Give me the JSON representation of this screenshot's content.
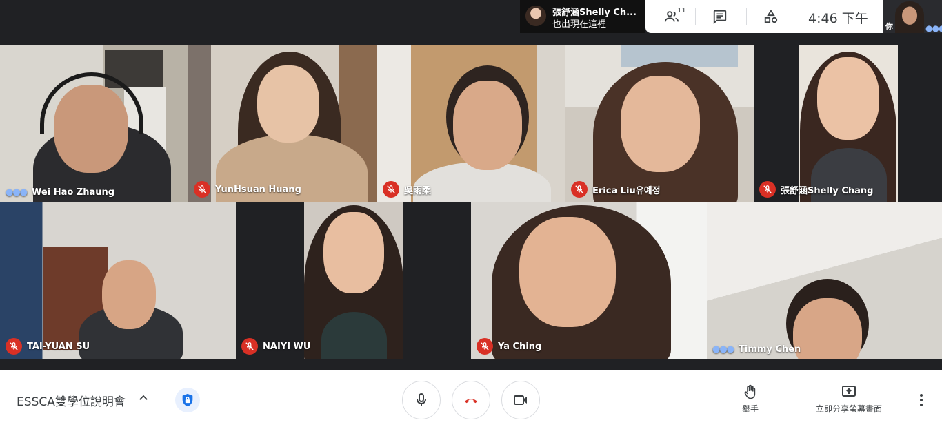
{
  "notification": {
    "name": "張舒涵Shelly Ch...",
    "message": "也出現在這裡"
  },
  "info_panel": {
    "participants_count": "11",
    "time": "4:46 下午"
  },
  "self_view": {
    "label": "你"
  },
  "tiles": [
    {
      "name": "Wei Hao Zhaung",
      "muted": false
    },
    {
      "name": "YunHsuan Huang",
      "muted": true
    },
    {
      "name": "吳雨柔",
      "muted": true
    },
    {
      "name": "Erica Liu유예정",
      "muted": true
    },
    {
      "name": "張舒涵Shelly Chang",
      "muted": true
    },
    {
      "name": "TAI-YUAN SU",
      "muted": true
    },
    {
      "name": "NAIYI WU",
      "muted": true
    },
    {
      "name": "Ya Ching",
      "muted": true
    },
    {
      "name": "Timmy Chen",
      "muted": false
    }
  ],
  "bottom_bar": {
    "meeting_title": "ESSCA雙學位說明會",
    "raise_hand_label": "舉手",
    "present_label": "立即分享螢幕畫面"
  },
  "colors": {
    "mute_red": "#d93025",
    "talking_blue": "#8ab4f8",
    "background": "#202124"
  }
}
